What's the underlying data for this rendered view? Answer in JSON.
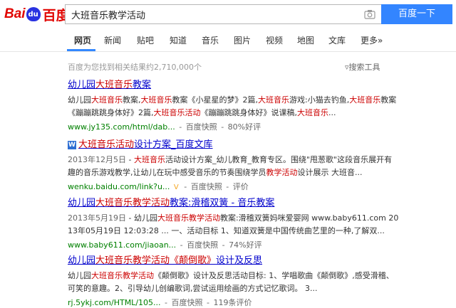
{
  "search": {
    "query": "大班音乐教学活动",
    "button": "百度一下"
  },
  "logo": {
    "part1": "Bai",
    "paw": "du",
    "part2": "百度"
  },
  "tabs": [
    "网页",
    "新闻",
    "贴吧",
    "知道",
    "音乐",
    "图片",
    "视频",
    "地图",
    "文库",
    "更多»"
  ],
  "stats": "百度为您找到相关结果约2,710,000个",
  "tools": "搜索工具",
  "results": [
    {
      "title_parts": [
        "幼儿园",
        "大班音乐",
        "教案"
      ],
      "abstract_html": "幼儿园<em>大班音乐</em>教案,<em>大班音乐</em>教案《小星星的梦》2篇,<em>大班音乐</em>游戏:小猫去钓鱼,<em>大班音乐</em>教案《蹦蹦跳跳身体好》2篇,<em>大班音乐活动</em>《蹦蹦跳跳身体好》说课稿,<em>大班音乐</em>...",
      "url": "www.jy135.com/html/dab...",
      "snapshot": "百度快照",
      "extra": "80%好评"
    },
    {
      "title_parts": [
        "",
        "大班音乐活动",
        "设计方案_百度文库"
      ],
      "icon": "W",
      "date": "2013年12月5日",
      "abstract_html": "<em>大班音乐</em>活动设计方案_幼儿教育_教育专区。围绕\"甩葱歌\"这段音乐展开有趣的音乐游戏教学,让幼儿在玩中感受音乐的节奏围绕学员<em>教学活动</em>设计展示 大班音...",
      "url": "wenku.baidu.com/link?u...",
      "badge": "V",
      "snapshot": "百度快照",
      "extra": "评价"
    },
    {
      "title_parts": [
        "幼儿园",
        "大班音乐教学活动",
        "教案:滑稽双簧 - 音乐教案"
      ],
      "date": "2013年5月19日",
      "abstract_html": "幼儿园<em>大班音乐教学活动</em>教案:滑稽双簧妈咪爱婴网 www.baby611.com 2013年05月19日 12:03:28 ... 一、活动目标 1、知道双簧是中国传统曲艺里的一种,了解双...",
      "url": "www.baby611.com/jiaoan...",
      "snapshot": "百度快照",
      "extra": "74%好评"
    },
    {
      "title_parts": [
        "幼儿园",
        "大班音乐教学活动《颠倒歌》",
        "设计及反思"
      ],
      "abstract_html": "幼儿园<em>大班音乐教学活动</em>《颠倒歌》设计及反思活动目标: 1、学唱歌曲《颠倒歌》,感受滑稽、可笑的意趣。2、引导幼儿创编歌词,尝试运用绘画的方式记忆歌词。 3...",
      "url": "rj.5ykj.com/HTML/105...",
      "snapshot": "百度快照",
      "extra": "119条评价"
    }
  ]
}
